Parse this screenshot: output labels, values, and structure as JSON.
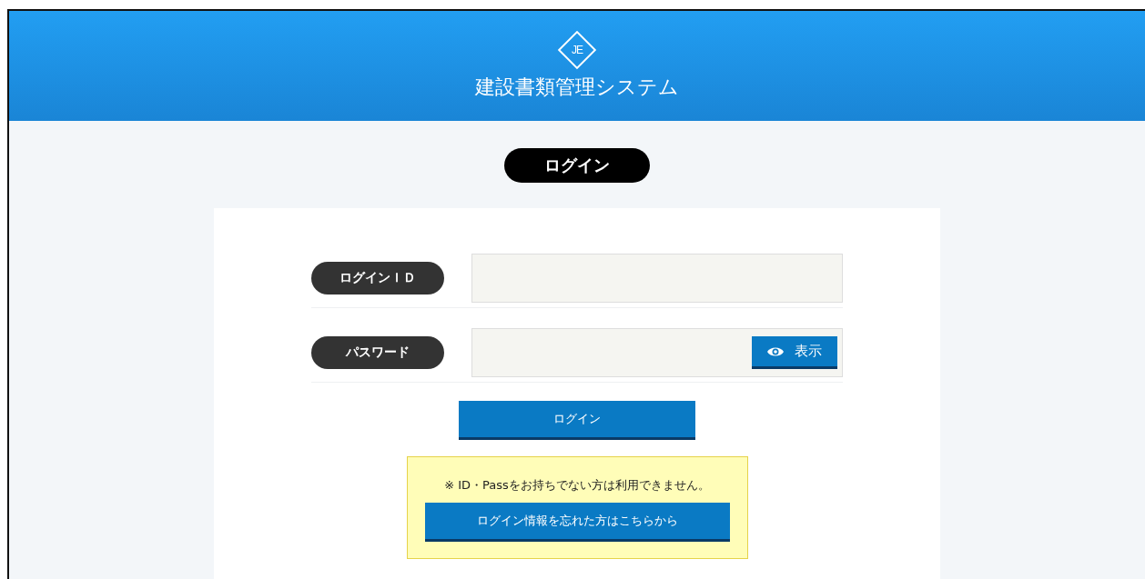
{
  "header": {
    "logo_text": "JE",
    "title": "建設書類管理システム"
  },
  "page_heading": "ログイン",
  "fields": [
    {
      "label": "ログインＩＤ",
      "kind": "text"
    },
    {
      "label": "パスワード",
      "kind": "password",
      "toggle_label": "表示"
    }
  ],
  "login_button": "ログイン",
  "notice": {
    "text": "※ ID・Passをお持ちでない方は利用できません。",
    "link_button": "ログイン情報を忘れた方はこちらから"
  }
}
